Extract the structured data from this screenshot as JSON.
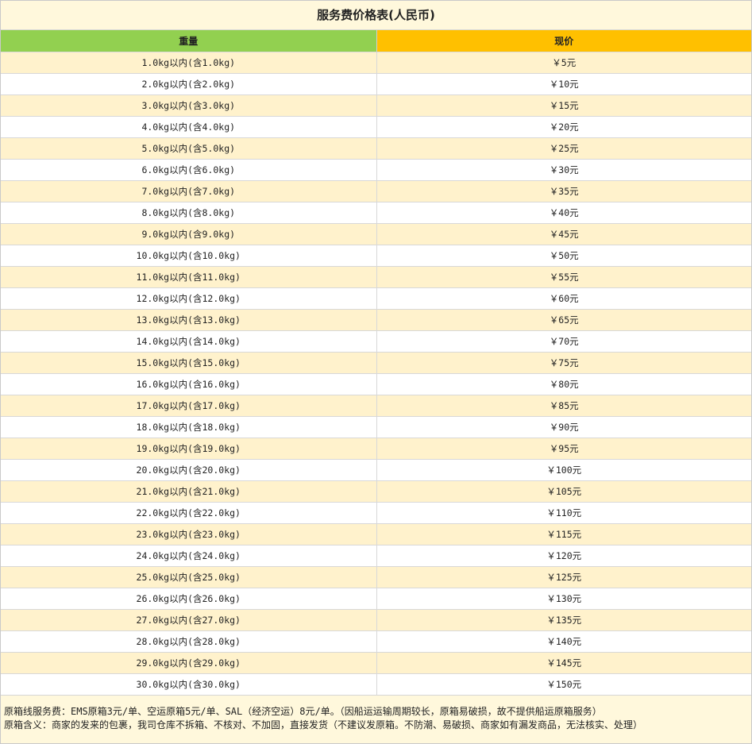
{
  "title": "服务费价格表(人民币)",
  "headers": {
    "weight": "重量",
    "price": "现价"
  },
  "colors": {
    "weight_header": "#92d050",
    "price_header": "#ffc000",
    "band_odd": "#fff2cc",
    "band_even": "#ffffff"
  },
  "rows": [
    {
      "weight": "1.0kg以内(含1.0kg)",
      "price": "￥5元"
    },
    {
      "weight": "2.0kg以内(含2.0kg)",
      "price": "￥10元"
    },
    {
      "weight": "3.0kg以内(含3.0kg)",
      "price": "￥15元"
    },
    {
      "weight": "4.0kg以内(含4.0kg)",
      "price": "￥20元"
    },
    {
      "weight": "5.0kg以内(含5.0kg)",
      "price": "￥25元"
    },
    {
      "weight": "6.0kg以内(含6.0kg)",
      "price": "￥30元"
    },
    {
      "weight": "7.0kg以内(含7.0kg)",
      "price": "￥35元"
    },
    {
      "weight": "8.0kg以内(含8.0kg)",
      "price": "￥40元"
    },
    {
      "weight": "9.0kg以内(含9.0kg)",
      "price": "￥45元"
    },
    {
      "weight": "10.0kg以内(含10.0kg)",
      "price": "￥50元"
    },
    {
      "weight": "11.0kg以内(含11.0kg)",
      "price": "￥55元"
    },
    {
      "weight": "12.0kg以内(含12.0kg)",
      "price": "￥60元"
    },
    {
      "weight": "13.0kg以内(含13.0kg)",
      "price": "￥65元"
    },
    {
      "weight": "14.0kg以内(含14.0kg)",
      "price": "￥70元"
    },
    {
      "weight": "15.0kg以内(含15.0kg)",
      "price": "￥75元"
    },
    {
      "weight": "16.0kg以内(含16.0kg)",
      "price": "￥80元"
    },
    {
      "weight": "17.0kg以内(含17.0kg)",
      "price": "￥85元"
    },
    {
      "weight": "18.0kg以内(含18.0kg)",
      "price": "￥90元"
    },
    {
      "weight": "19.0kg以内(含19.0kg)",
      "price": "￥95元"
    },
    {
      "weight": "20.0kg以内(含20.0kg)",
      "price": "￥100元"
    },
    {
      "weight": "21.0kg以内(含21.0kg)",
      "price": "￥105元"
    },
    {
      "weight": "22.0kg以内(含22.0kg)",
      "price": "￥110元"
    },
    {
      "weight": "23.0kg以内(含23.0kg)",
      "price": "￥115元"
    },
    {
      "weight": "24.0kg以内(含24.0kg)",
      "price": "￥120元"
    },
    {
      "weight": "25.0kg以内(含25.0kg)",
      "price": "￥125元"
    },
    {
      "weight": "26.0kg以内(含26.0kg)",
      "price": "￥130元"
    },
    {
      "weight": "27.0kg以内(含27.0kg)",
      "price": "￥135元"
    },
    {
      "weight": "28.0kg以内(含28.0kg)",
      "price": "￥140元"
    },
    {
      "weight": "29.0kg以内(含29.0kg)",
      "price": "￥145元"
    },
    {
      "weight": "30.0kg以内(含30.0kg)",
      "price": "￥150元"
    }
  ],
  "notes": [
    "原箱线服务费：EMS原箱3元/单、空运原箱5元/单、SAL（经济空运）8元/单。（因船运运输周期较长，原箱易破损，故不提供船运原箱服务）",
    "原箱含义：商家的发来的包裹，我司仓库不拆箱、不核对、不加固，直接发货（不建议发原箱。不防潮、易破损、商家如有漏发商品，无法核实、处理）"
  ]
}
